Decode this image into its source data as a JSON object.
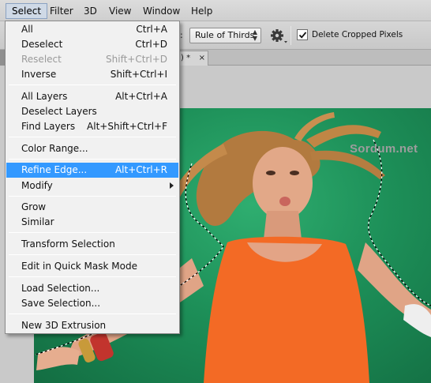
{
  "menubar": {
    "items": [
      {
        "label": "Select"
      },
      {
        "label": "Filter"
      },
      {
        "label": "3D"
      },
      {
        "label": "View"
      },
      {
        "label": "Window"
      },
      {
        "label": "Help"
      }
    ]
  },
  "options": {
    "colon": ":",
    "crop_overlay": "Rule of Thirds",
    "delete_cropped_label": "Delete Cropped Pixels",
    "delete_cropped_checked": true
  },
  "tab": {
    "title_fragment": ") *",
    "close_glyph": "×"
  },
  "watermark": "Sordum.net",
  "select_menu": {
    "items": [
      {
        "label": "All",
        "shortcut": "Ctrl+A"
      },
      {
        "label": "Deselect",
        "shortcut": "Ctrl+D"
      },
      {
        "label": "Reselect",
        "shortcut": "Shift+Ctrl+D",
        "disabled": true
      },
      {
        "label": "Inverse",
        "shortcut": "Shift+Ctrl+I"
      },
      {
        "label": "All Layers",
        "shortcut": "Alt+Ctrl+A"
      },
      {
        "label": "Deselect Layers",
        "shortcut": ""
      },
      {
        "label": "Find Layers",
        "shortcut": "Alt+Shift+Ctrl+F"
      },
      {
        "label": "Color Range...",
        "shortcut": ""
      },
      {
        "label": "Refine Edge...",
        "shortcut": "Alt+Ctrl+R",
        "highlighted": true
      },
      {
        "label": "Modify",
        "shortcut": "",
        "submenu": true
      },
      {
        "label": "Grow",
        "shortcut": ""
      },
      {
        "label": "Similar",
        "shortcut": ""
      },
      {
        "label": "Transform Selection",
        "shortcut": ""
      },
      {
        "label": "Edit in Quick Mask Mode",
        "shortcut": ""
      },
      {
        "label": "Load Selection...",
        "shortcut": ""
      },
      {
        "label": "Save Selection...",
        "shortcut": ""
      },
      {
        "label": "New 3D Extrusion",
        "shortcut": ""
      }
    ]
  },
  "colors": {
    "highlight": "#3399ff",
    "canvas_green": "#1d8f58",
    "top_orange": "#f36a25"
  }
}
